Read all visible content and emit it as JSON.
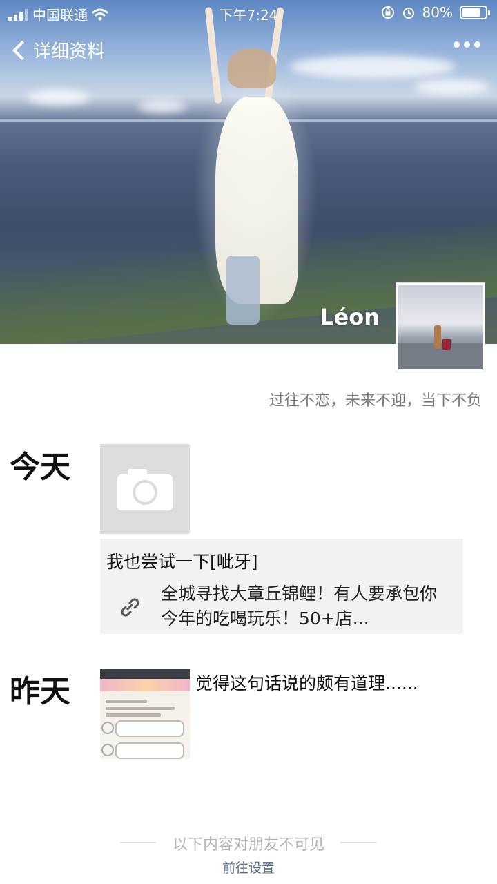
{
  "status_bar": {
    "carrier": "中国联通",
    "time": "下午7:24",
    "battery_percent": "80%",
    "battery_level": 0.8,
    "icons": [
      "signal-icon",
      "wifi-icon",
      "orientation-lock-icon",
      "alarm-icon",
      "battery-icon"
    ]
  },
  "nav": {
    "back_label": "详细资料",
    "more_icon": "more-dots-icon"
  },
  "profile": {
    "name": "Léon",
    "signature": "过往不恋，未来不迎，当下不负"
  },
  "moments": [
    {
      "day": "今天",
      "post_text": "我也尝试一下[呲牙]",
      "link_text": "全城寻找大章丘锦鲤！有人要承包你今年的吃喝玩乐！50+店..."
    },
    {
      "day": "昨天",
      "caption": "觉得这句话说的颇有道理......"
    }
  ],
  "footer": {
    "note": "以下内容对朋友不可见",
    "link": "前往设置"
  },
  "colors": {
    "accent_link": "#5d6d8f",
    "muted_text": "#7a7a7a",
    "card_bg": "#f2f2f3"
  }
}
